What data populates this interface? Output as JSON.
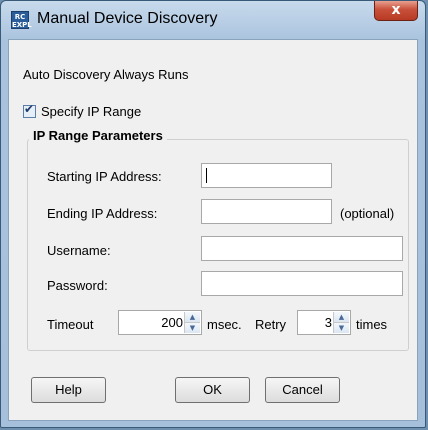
{
  "window": {
    "title": "Manual Device Discovery",
    "icon_text": "RC EXPL",
    "close_label": "x"
  },
  "auto_discovery_label": "Auto Discovery Always Runs",
  "specify_ip_range": {
    "label": "Specify IP Range",
    "checked": true
  },
  "ip_range": {
    "group_title": "IP Range Parameters",
    "starting_ip": {
      "label": "Starting IP Address:",
      "value": ""
    },
    "ending_ip": {
      "label": "Ending IP Address:",
      "value": "",
      "hint": "(optional)"
    },
    "username": {
      "label": "Username:",
      "value": ""
    },
    "password": {
      "label": "Password:",
      "value": ""
    },
    "timeout": {
      "label": "Timeout",
      "value": "200",
      "unit": "msec."
    },
    "retry": {
      "label": "Retry",
      "value": "3",
      "unit": "times"
    }
  },
  "buttons": {
    "help": "Help",
    "ok": "OK",
    "cancel": "Cancel"
  },
  "icons": {
    "spin_up": "spin-up-arrow",
    "spin_down": "spin-down-arrow",
    "check": "check-icon"
  }
}
